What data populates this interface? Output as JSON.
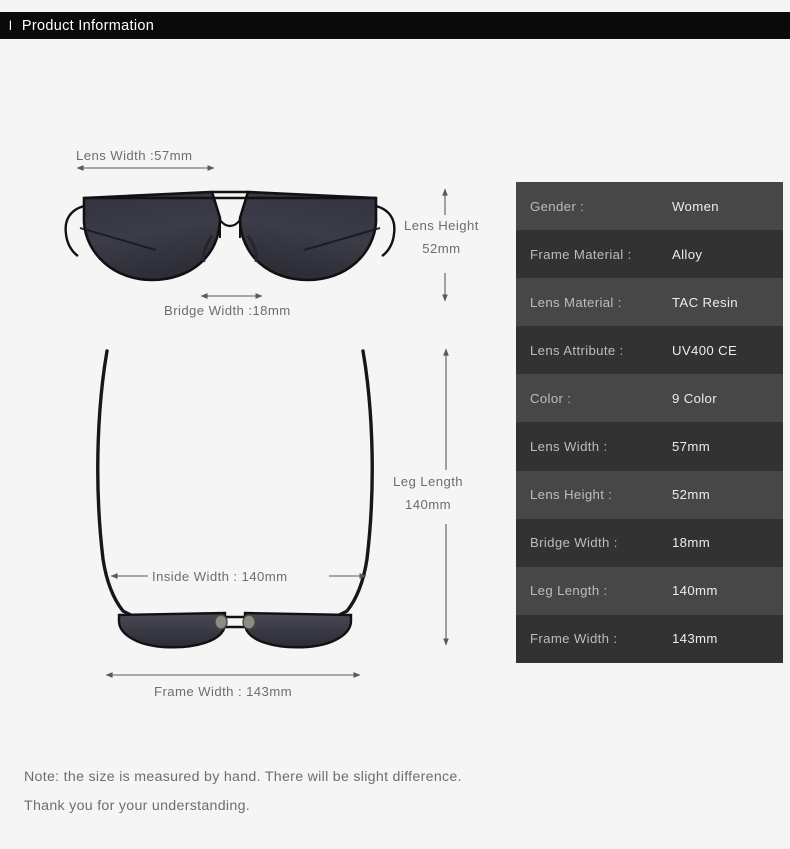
{
  "header": {
    "tick": "l",
    "title": "Product Information"
  },
  "spec_table": {
    "rows": [
      {
        "label": "Gender :",
        "value": "Women"
      },
      {
        "label": "Frame Material :",
        "value": "Alloy"
      },
      {
        "label": "Lens Material :",
        "value": "TAC Resin"
      },
      {
        "label": "Lens Attribute :",
        "value": "UV400 CE"
      },
      {
        "label": "Color :",
        "value": "9 Color"
      },
      {
        "label": "Lens Width :",
        "value": "57mm"
      },
      {
        "label": "Lens Height :",
        "value": "52mm"
      },
      {
        "label": "Bridge Width :",
        "value": "18mm"
      },
      {
        "label": "Leg Length :",
        "value": "140mm"
      },
      {
        "label": "Frame Width :",
        "value": "143mm"
      }
    ]
  },
  "diagram": {
    "front_view": {
      "lens_width_label": "Lens Width :57mm",
      "bridge_width_label": "Bridge Width :18mm",
      "lens_height_label_line1": "Lens Height",
      "lens_height_label_line2": "52mm"
    },
    "top_view": {
      "leg_length_label_line1": "Leg Length",
      "leg_length_label_line2": "140mm",
      "inside_width_label": "Inside  Width : 140mm",
      "frame_width_label": "Frame Width : 143mm"
    }
  },
  "note": {
    "line1": "Note: the size is measured by hand. There will be slight difference.",
    "line2": "Thank you for your understanding."
  },
  "colors": {
    "page_background": "#f5f5f5",
    "header_background": "#0a0a0a",
    "header_text": "#ffffff",
    "row_light": "#474747",
    "row_dark": "#323232",
    "label_text": "#bcbcbc",
    "value_text": "#ececec",
    "dimension_text": "#6e6e6e",
    "arrow": "#5a5a5a",
    "frame": "#111111",
    "lens": "#3a3a46"
  }
}
